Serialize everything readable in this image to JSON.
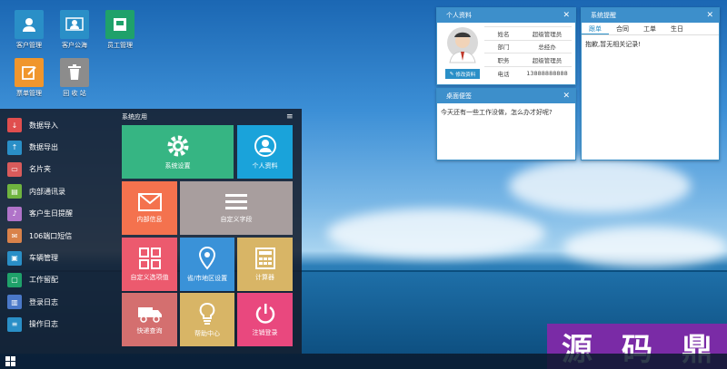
{
  "desktop_icons": [
    {
      "label": "客户管理",
      "icon": "contacts-icon",
      "color": "#2a8fc7"
    },
    {
      "label": "客户公海",
      "icon": "users-icon",
      "color": "#2a8fc7"
    },
    {
      "label": "员工管理",
      "icon": "employee-icon",
      "color": "#1fa16a"
    },
    {
      "label": "票单管理",
      "icon": "edit-doc-icon",
      "color": "#f0962d"
    },
    {
      "label": "回 收 站",
      "icon": "trash-icon",
      "color": "#8c8c8c"
    }
  ],
  "start_menu": {
    "items": [
      {
        "label": "数据导入",
        "icon": "download-icon",
        "color": "#e04e4e"
      },
      {
        "label": "数据导出",
        "icon": "upload-icon",
        "color": "#2a8fc7"
      },
      {
        "label": "名片夹",
        "icon": "card-icon",
        "color": "#d95b5b"
      },
      {
        "label": "内部通讯录",
        "icon": "book-icon",
        "color": "#6fb43f"
      },
      {
        "label": "客户生日提醒",
        "icon": "bell-icon",
        "color": "#b073c9"
      },
      {
        "label": "106端口短信",
        "icon": "mail-icon",
        "color": "#d9824a"
      },
      {
        "label": "车辆管理",
        "icon": "car-icon",
        "color": "#2a8fc7"
      },
      {
        "label": "工作留配",
        "icon": "chat-icon",
        "color": "#1fa16a"
      },
      {
        "label": "登录日志",
        "icon": "log-icon",
        "color": "#4a78c8"
      },
      {
        "label": "操作日志",
        "icon": "list-icon",
        "color": "#2a8fc7"
      }
    ],
    "apps_title": "系统应用",
    "tiles": [
      {
        "label": "系统设置",
        "icon": "gear-icon",
        "color": "#36b583"
      },
      {
        "label": "个人资料",
        "icon": "user-icon",
        "color": "#1aa3da"
      },
      {
        "label": "内部信息",
        "icon": "mail-icon",
        "color": "#f4724e"
      },
      {
        "label": "自定义字段",
        "icon": "menu-icon",
        "color": "#a89e9e"
      },
      {
        "label": "自定义选项值",
        "icon": "grid-icon",
        "color": "#ec5a6e"
      },
      {
        "label": "省/市地区设置",
        "icon": "location-icon",
        "color": "#3a92d8"
      },
      {
        "label": "计算器",
        "icon": "calculator-icon",
        "color": "#d8b566"
      },
      {
        "label": "快递查询",
        "icon": "truck-icon",
        "color": "#d46f6f"
      },
      {
        "label": "帮助中心",
        "icon": "bulb-icon",
        "color": "#d8b566"
      },
      {
        "label": "注销登录",
        "icon": "power-icon",
        "color": "#e9487e"
      }
    ]
  },
  "profile_widget": {
    "title": "个人资料",
    "edit_label": "修改资料",
    "rows": [
      {
        "key": "姓名",
        "value": "超级管理员"
      },
      {
        "key": "部门",
        "value": "总经办"
      },
      {
        "key": "职务",
        "value": "超级管理员"
      },
      {
        "key": "电话",
        "value": "13888888888"
      }
    ]
  },
  "reminder_widget": {
    "title": "系统提醒",
    "tabs": [
      "跟单",
      "合同",
      "工单",
      "生日"
    ],
    "message": "抱歉,暂无相关记录!"
  },
  "note_widget": {
    "title": "桌面便签",
    "text": "今天还有一些工作没做，怎么办才好呢?"
  },
  "watermark": [
    "源",
    "码",
    "鼎"
  ]
}
